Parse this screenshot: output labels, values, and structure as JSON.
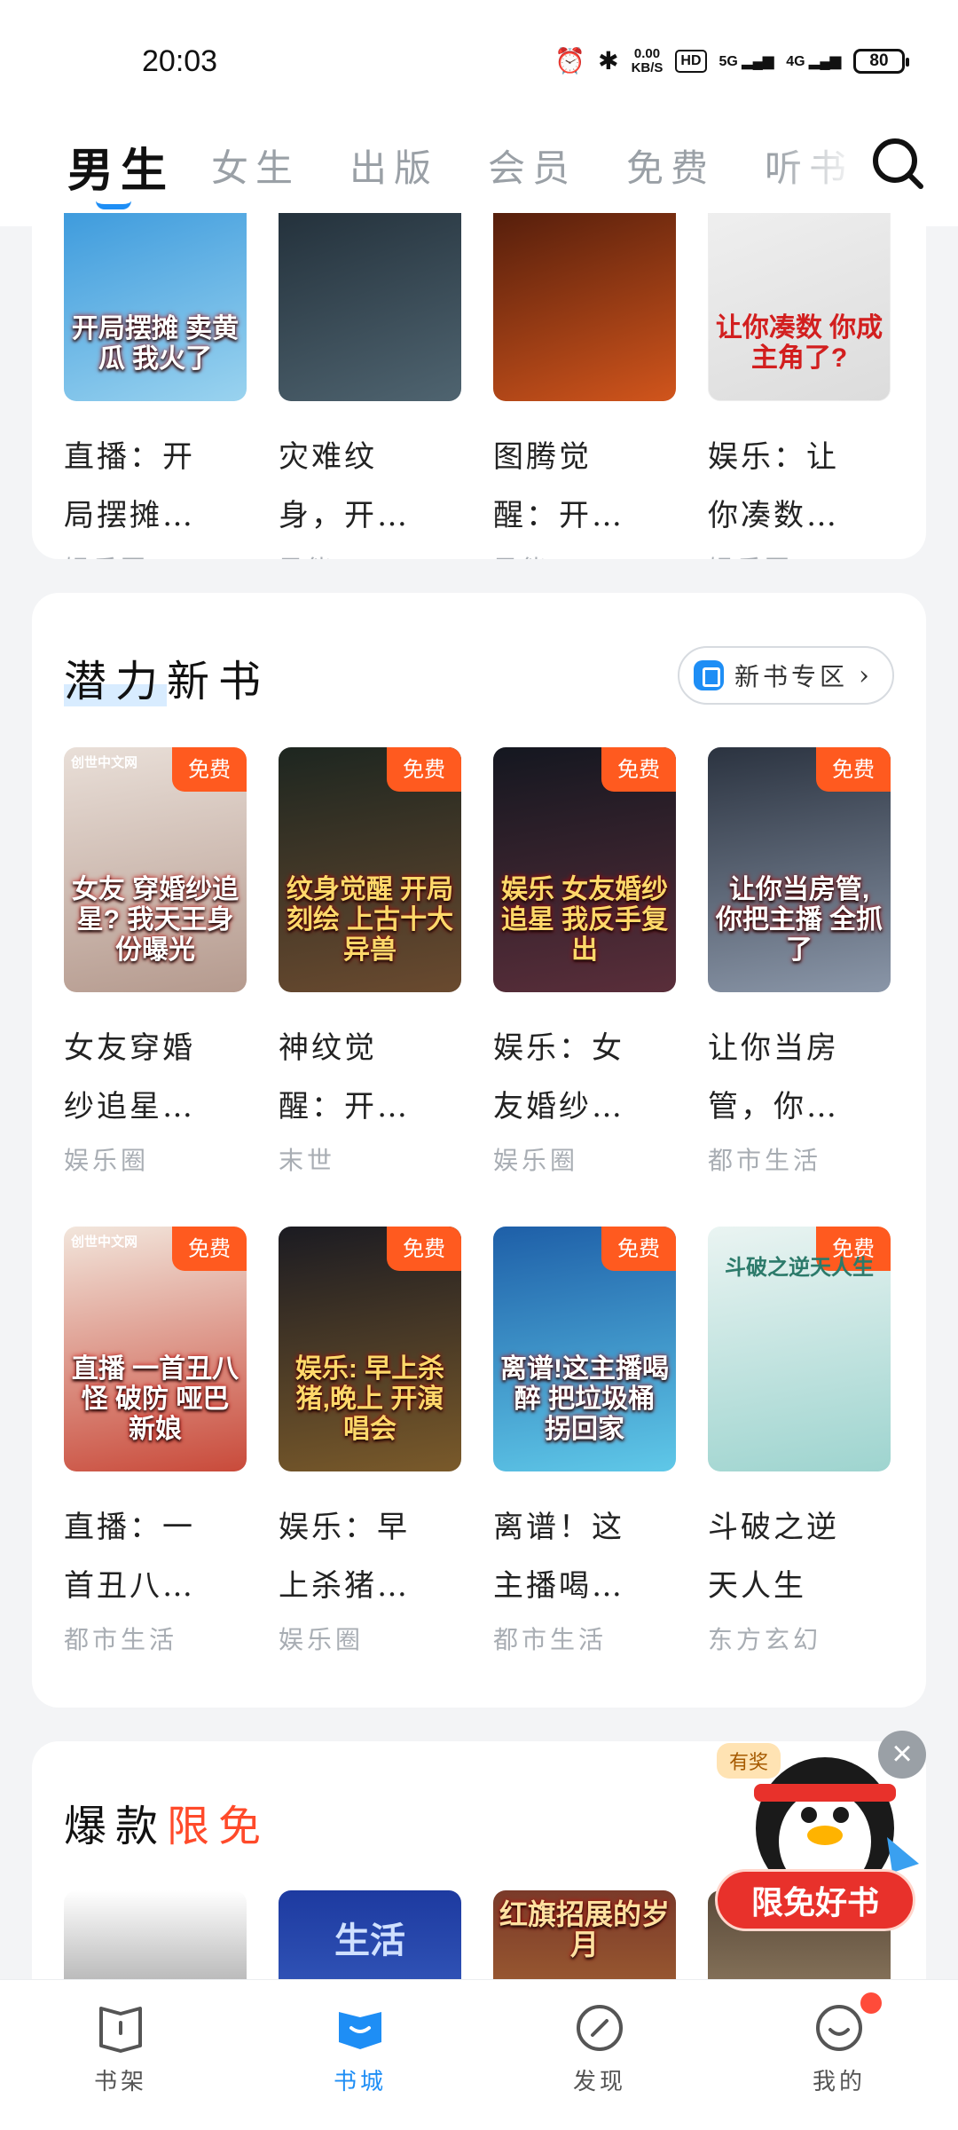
{
  "status_bar": {
    "time": "20:03",
    "net_speed_value": "0.00",
    "net_speed_unit": "KB/S",
    "hd_label": "HD",
    "signal_1": "5G",
    "signal_2": "4G",
    "battery": "80"
  },
  "tabs": [
    {
      "label": "男生"
    },
    {
      "label": "女生"
    },
    {
      "label": "出版"
    },
    {
      "label": "会员"
    },
    {
      "label": "免费"
    },
    {
      "label": "听书"
    }
  ],
  "top_books": [
    {
      "cover_text": "开局摆摊 卖黄瓜 我火了",
      "title": "直播：开局摆摊…",
      "title_l1": "直播：开",
      "title_l2": "局摆摊…",
      "genre": "娱乐圈",
      "c1": "#2a8fd9",
      "c2": "#9ad3ef"
    },
    {
      "cover_text": "",
      "title": "灾难纹身，开…",
      "title_l1": "灾难纹",
      "title_l2": "身，开…",
      "genre": "异能",
      "c1": "#1a2630",
      "c2": "#4f6470"
    },
    {
      "cover_text": "",
      "title": "图腾觉醒：开…",
      "title_l1": "图腾觉",
      "title_l2": "醒：开…",
      "genre": "异能",
      "c1": "#3a1208",
      "c2": "#d1551c"
    },
    {
      "cover_text": "让你凑数 你成主角了?",
      "title": "娱乐：让你凑数…",
      "title_l1": "娱乐：让",
      "title_l2": "你凑数…",
      "genre": "娱乐圈",
      "c1": "#f3f3f3",
      "c2": "#dcdcdc"
    }
  ],
  "potential": {
    "title_a": "潜力",
    "title_b": "新书",
    "zone_label": "新书专区",
    "free_label": "免费",
    "books": [
      {
        "brand": "创世中文网",
        "cover_text": "女友 穿婚纱追星? 我天王身份曝光",
        "title_l1": "女友穿婚",
        "title_l2": "纱追星…",
        "genre": "娱乐圈",
        "c1": "#e9dfd8",
        "c2": "#b59a8e"
      },
      {
        "brand": "",
        "cover_text": "纹身觉醒 开局刻绘 上古十大异兽",
        "title_l1": "神纹觉",
        "title_l2": "醒：开…",
        "genre": "末世",
        "c1": "#1d2620",
        "c2": "#6a4a2f"
      },
      {
        "brand": "",
        "cover_text": "娱乐 女友婚纱追星 我反手复出",
        "title_l1": "娱乐：女",
        "title_l2": "友婚纱…",
        "genre": "娱乐圈",
        "c1": "#141720",
        "c2": "#5a2e3a"
      },
      {
        "brand": "",
        "cover_text": "让你当房管, 你把主播 全抓了",
        "title_l1": "让你当房",
        "title_l2": "管，你…",
        "genre": "都市生活",
        "c1": "#2b3340",
        "c2": "#8a96a8"
      },
      {
        "brand": "创世中文网",
        "cover_text": "直播 一首丑八怪 破防 哑巴新娘",
        "title_l1": "直播：一",
        "title_l2": "首丑八…",
        "genre": "都市生活",
        "c1": "#f2e6dc",
        "c2": "#c94a3a"
      },
      {
        "brand": "",
        "cover_text": "娱乐: 早上杀猪,晚上 开演唱会",
        "title_l1": "娱乐：早",
        "title_l2": "上杀猪…",
        "genre": "娱乐圈",
        "c1": "#1b1b22",
        "c2": "#7a5a2a"
      },
      {
        "brand": "",
        "cover_text": "离谱!这主播喝醉 把垃圾桶 拐回家",
        "title_l1": "离谱！这",
        "title_l2": "主播喝…",
        "genre": "都市生活",
        "c1": "#1e5fa8",
        "c2": "#5fc8e8"
      },
      {
        "brand": "",
        "cover_text": "斗破之逆天人生",
        "title_l1": "斗破之逆",
        "title_l2": "天人生",
        "genre": "东方玄幻",
        "c1": "#eaf4f2",
        "c2": "#9ed4cf"
      }
    ]
  },
  "hot": {
    "title_a": "爆款",
    "title_b": "限免",
    "books": [
      {
        "cover_text": "",
        "c1": "#ffffff",
        "c2": "#444444"
      },
      {
        "cover_text": "生活",
        "c1": "#1d3aa0",
        "c2": "#4e7ad8"
      },
      {
        "cover_text": "红旗招展的岁月",
        "c1": "#7a3a2a",
        "c2": "#c8873a"
      },
      {
        "cover_text": "",
        "c1": "#5a4a3a",
        "c2": "#c8b08a"
      }
    ]
  },
  "promo": {
    "award_label": "有奖",
    "button_label": "限免好书",
    "close_glyph": "×"
  },
  "bottom_nav": [
    {
      "label": "书架"
    },
    {
      "label": "书城"
    },
    {
      "label": "发现"
    },
    {
      "label": "我的"
    }
  ],
  "colors": {
    "accent": "#1e8ef5",
    "free_badge": "#ff5a1f",
    "promo_red": "#e8312b"
  }
}
